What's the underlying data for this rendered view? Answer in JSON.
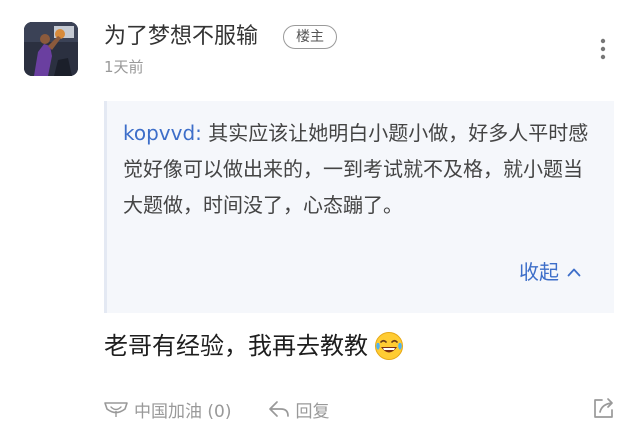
{
  "post": {
    "author": {
      "name": "为了梦想不服输",
      "badge": "楼主",
      "avatar_icon": "avatar-basketball-player"
    },
    "time": "1天前",
    "menu_icon": "more-vertical-icon",
    "quote": {
      "author": "kopvvd:",
      "text": " 其实应该让她明白小题小做，好多人平时感觉好像可以做出来的，一到考试就不及格，就小题当大题做，时间没了，心态蹦了。",
      "collapse_label": "收起",
      "collapse_icon": "chevron-up-icon"
    },
    "content": "老哥有经验，我再去教教",
    "content_emoji": "laughing-tears-emoji",
    "actions": {
      "cheer_label": "中国加油 (0)",
      "cheer_icon": "cheer-icon",
      "reply_label": "回复",
      "reply_icon": "reply-icon",
      "share_icon": "share-icon"
    }
  },
  "colors": {
    "link_blue": "#3d6ec9",
    "quote_bg": "#f5f7fb",
    "meta_gray": "#999999"
  }
}
